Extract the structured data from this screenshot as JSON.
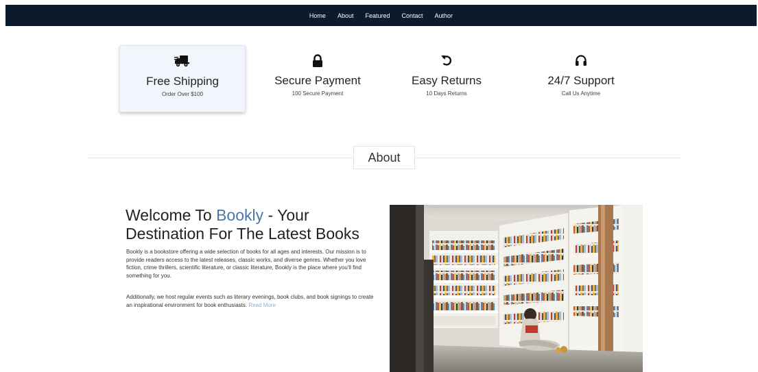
{
  "nav": {
    "items": [
      {
        "label": "Home"
      },
      {
        "label": "About"
      },
      {
        "label": "Featured"
      },
      {
        "label": "Contact"
      },
      {
        "label": "Author"
      }
    ]
  },
  "features": [
    {
      "icon": "truck-icon",
      "title": "Free Shipping",
      "subtitle": "Order Over $100",
      "active": true
    },
    {
      "icon": "lock-icon",
      "title": "Secure Payment",
      "subtitle": "100 Secure Payment",
      "active": false
    },
    {
      "icon": "undo-icon",
      "title": "Easy Returns",
      "subtitle": "10 Days Returns",
      "active": false
    },
    {
      "icon": "headphones-icon",
      "title": "24/7 Support",
      "subtitle": "Call Us Anytime",
      "active": false
    }
  ],
  "about": {
    "section_title": "About",
    "headline_prefix": "Welcome To ",
    "headline_brand": "Bookly",
    "headline_suffix": " - Your Destination For The Latest Books",
    "paragraph1": "Bookly is a bookstore offering a wide selection of books for all ages and interests. Our mission is to provide readers access to the latest releases, classic works, and diverse genres. Whether you love fiction, crime thrillers, scientific literature, or classic literature, Bookly is the place where you'll find something for you.",
    "paragraph2": "Additionally, we host regular events such as literary evenings, book clubs, and book signings to create an inspirational environment for book enthusiasts.",
    "read_more": "Read More"
  },
  "colors": {
    "navbar_bg": "#0b1b2b",
    "brand_accent": "#4a77a8",
    "link": "#8fb1db",
    "active_card_bg": "#f1f6fc"
  }
}
